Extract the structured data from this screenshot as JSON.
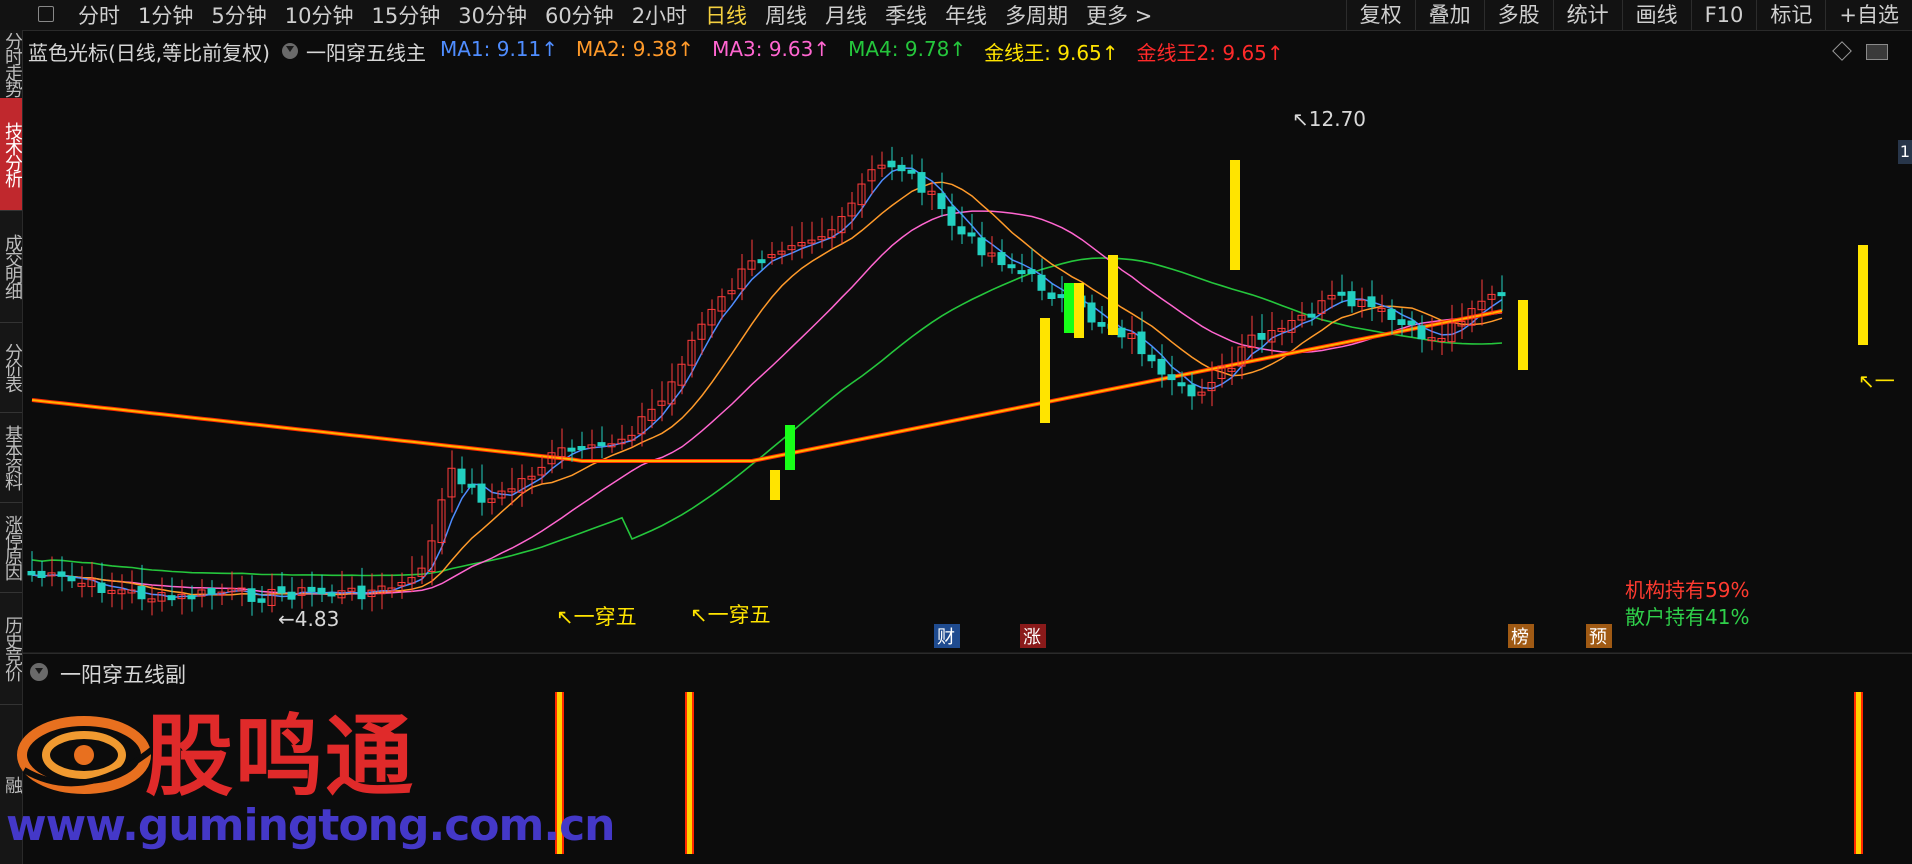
{
  "toolbar": {
    "periods": [
      "分时",
      "1分钟",
      "5分钟",
      "10分钟",
      "15分钟",
      "30分钟",
      "60分钟",
      "2小时",
      "日线",
      "周线",
      "月线",
      "季线",
      "年线",
      "多周期",
      "更多 >"
    ],
    "active_period": "日线",
    "buttons": [
      "复权",
      "叠加",
      "多股",
      "统计",
      "画线",
      "F10",
      "标记",
      "+自选"
    ]
  },
  "sidebar": {
    "tabs": [
      {
        "label": "分时走势",
        "active": false
      },
      {
        "label": "技术分析",
        "active": true
      },
      {
        "label": "成交明细",
        "active": false
      },
      {
        "label": "分价表",
        "active": false
      },
      {
        "label": "基本资料",
        "active": false
      },
      {
        "label": "涨停原因",
        "active": false
      },
      {
        "label": "历史竞价",
        "active": false
      },
      {
        "label": "融",
        "active": false
      }
    ]
  },
  "indicator_bar": {
    "title": "蓝色光标(日线,等比前复权)",
    "formula": "一阳穿五线主",
    "items": [
      {
        "label": "MA1: 9.11↑",
        "color": "#4f8dff"
      },
      {
        "label": "MA2: 9.38↑",
        "color": "#ff9a2a"
      },
      {
        "label": "MA3: 9.63↑",
        "color": "#ff66d0"
      },
      {
        "label": "MA4: 9.78↑",
        "color": "#25c63c"
      },
      {
        "label": "金线王: 9.65↑",
        "color": "#ffe400"
      },
      {
        "label": "金线王2: 9.65↑",
        "color": "#ff2a2a"
      }
    ]
  },
  "annotations": {
    "high": "12.70",
    "low": "4.83",
    "signal_a": "↖一穿五",
    "signal_b": "↖一穿五",
    "right_arrow": "↖一",
    "tags": [
      {
        "text": "财",
        "bg": "#1f4b8f"
      },
      {
        "text": "涨",
        "bg": "#8a1a1a"
      },
      {
        "text": "榜",
        "bg": "#a05a14"
      },
      {
        "text": "预",
        "bg": "#a05a14"
      }
    ]
  },
  "holdings": {
    "institution": "机构持有59%",
    "retail": "散户持有41%"
  },
  "sub_panel": {
    "title": "一阳穿五线副"
  },
  "watermark": {
    "title": "股鸣通",
    "url": "www.gumingtong.com.cn"
  },
  "right_marker": "1",
  "colors": {
    "up": "#ff3b3b",
    "down": "#22d0c0",
    "signal": "#ffe400",
    "signal_green": "#18ff18",
    "ma1": "#4f8dff",
    "ma2": "#ff9a2a",
    "ma3": "#ff66d0",
    "ma4": "#25c63c"
  }
}
